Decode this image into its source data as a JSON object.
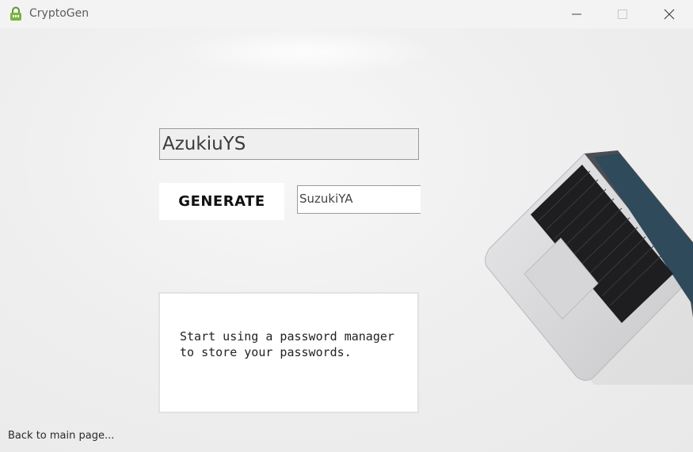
{
  "window": {
    "title": "CryptoGen",
    "icon": "lock-icon"
  },
  "main": {
    "password_value": "AzukiuYS",
    "generate_label": "GENERATE",
    "seed_value": "SuzukiYA",
    "tip_text": "Start using a password manager\nto store your passwords.",
    "back_link": "Back to main page..."
  },
  "colors": {
    "background": "#efefef",
    "lock_icon": "#7cb342"
  }
}
